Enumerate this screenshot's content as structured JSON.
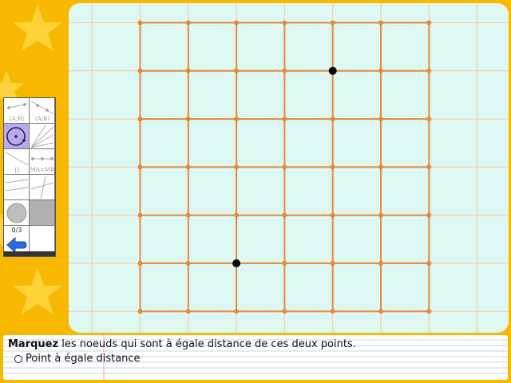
{
  "instruction": {
    "verb": "Marquez",
    "text": " les noeuds qui sont à égale distance de ces deux points."
  },
  "option": {
    "label": "Point à égale distance"
  },
  "toolbox": {
    "tools": [
      {
        "name": "segment-tool",
        "label": "[A;B]"
      },
      {
        "name": "segment-ab-tool",
        "label": "(A;B)"
      },
      {
        "name": "circle-tool",
        "label": ""
      },
      {
        "name": "lines-tool",
        "label": ""
      },
      {
        "name": "ray-tool",
        "label": "∏"
      },
      {
        "name": "midpoint-tool",
        "label": "MA=MB"
      },
      {
        "name": "line-tool",
        "label": ""
      },
      {
        "name": "perpendicular-tool",
        "label": ""
      },
      {
        "name": "point-tool",
        "label": ""
      },
      {
        "name": "grey-tool",
        "label": ""
      }
    ],
    "counter": "0/3",
    "back_icon": "blue-left-arrow-icon"
  },
  "grid": {
    "columns": 7,
    "rows": 7,
    "marked_points": [
      [
        4,
        1
      ],
      [
        2,
        5
      ]
    ]
  },
  "colors": {
    "background": "#f8b800",
    "canvas": "#dff7f2",
    "grid_line": "#e08a3c",
    "point": "#000000",
    "selected_tool": "#b9a9f2"
  }
}
